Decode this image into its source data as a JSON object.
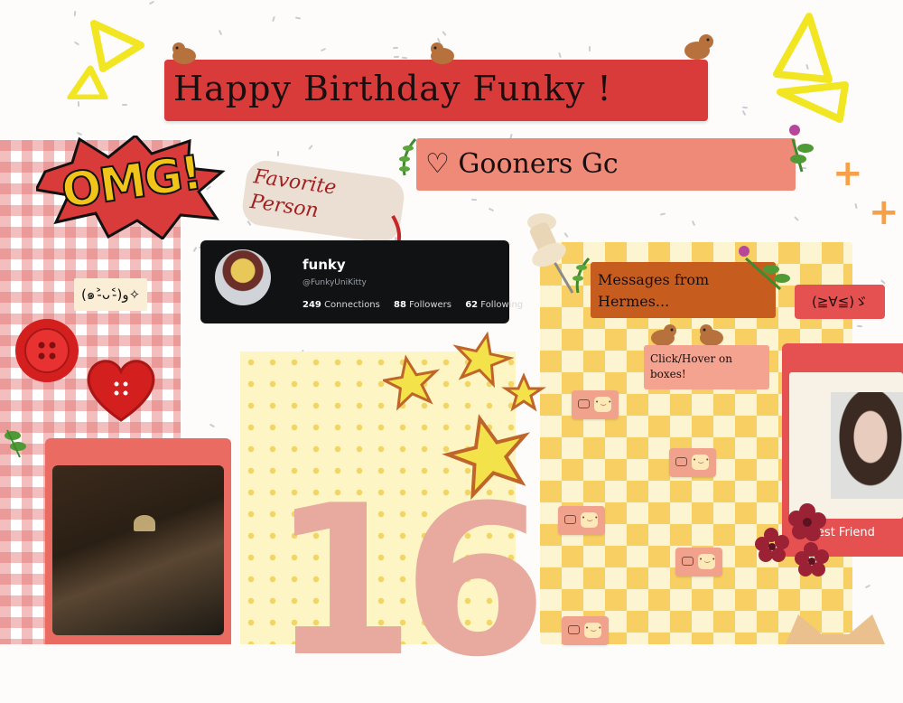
{
  "title": "Happy Birthday Funky !",
  "subtitle": "♡ Gooners Gc",
  "profile": {
    "name": "funky",
    "handle": "@FunkyUniKitty",
    "connections": "249",
    "connections_label": "Connections",
    "followers": "88",
    "followers_label": "Followers",
    "following": "62",
    "following_label": "Following"
  },
  "stickers": {
    "omg": "OMG!",
    "favorite_person": "Favorite Person",
    "kaomoji_left": "(๑˃̵ᴗ˂̵)و✧",
    "kaomoji_right": "(≧∀≦)ゞ",
    "number": "16"
  },
  "messages": {
    "header": "Messages from Hermes...",
    "hint": "Click/Hover on boxes!"
  },
  "best_friend_label": "Best Friend",
  "colors": {
    "banner_red": "#d93a3a",
    "banner_salmon": "#ef8a78",
    "message_orange": "#c75c1f",
    "bubble": "#f0a28d"
  },
  "icons": [
    "puppy-sticker-icon",
    "star-icon",
    "flower-icon",
    "pushpin-icon",
    "button-icon",
    "heart-button-icon",
    "chat-bubble-icon",
    "leaf-icon",
    "plus-icon",
    "triangle-icon"
  ]
}
